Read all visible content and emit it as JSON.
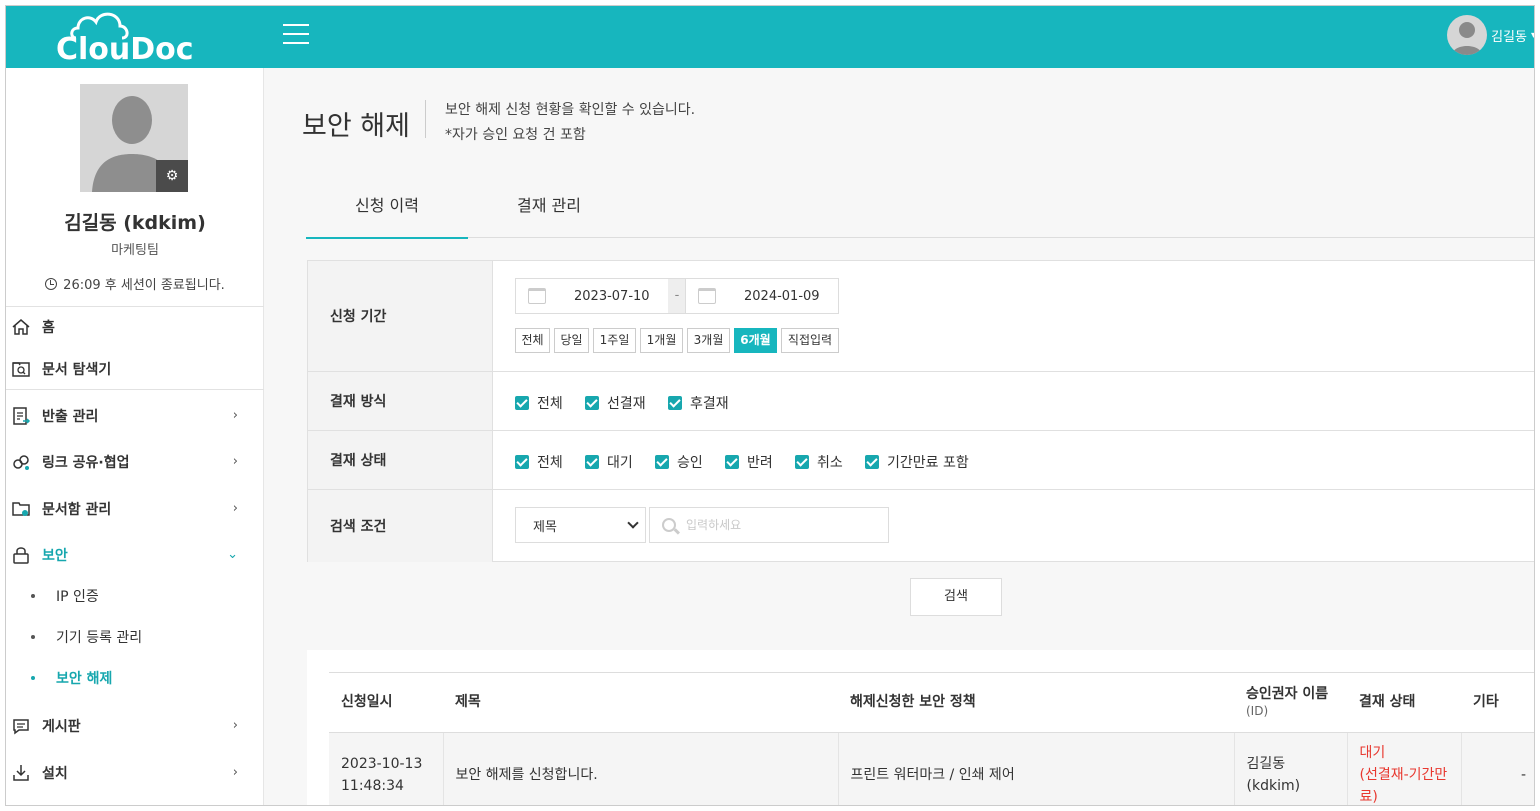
{
  "header": {
    "logo_text": "ClouDoc",
    "user_name": "김길동"
  },
  "sidebar": {
    "profile_name": "김길동 (kdkim)",
    "department": "마케팅팀",
    "session_text": "26:09 후 세션이 종료됩니다.",
    "items": [
      {
        "label": "홈",
        "icon": "home-icon"
      },
      {
        "label": "문서 탐색기",
        "icon": "folder-search-icon"
      },
      {
        "label": "반출 관리",
        "icon": "export-doc-icon"
      },
      {
        "label": "링크 공유·협업",
        "icon": "link-share-icon"
      },
      {
        "label": "문서함 관리",
        "icon": "folder-settings-icon"
      },
      {
        "label": "보안",
        "icon": "lock-icon"
      },
      {
        "label": "게시판",
        "icon": "board-icon"
      },
      {
        "label": "설치",
        "icon": "download-icon"
      }
    ],
    "security_sub": [
      "IP 인증",
      "기기 등록 관리",
      "보안 해제"
    ]
  },
  "page": {
    "title": "보안 해제",
    "desc_line1": "보안 해제 신청 현황을 확인할 수 있습니다.",
    "desc_line2": "*자가 승인 요청 건 포함"
  },
  "tabs": [
    "신청 이력",
    "결재 관리"
  ],
  "filter": {
    "period_label": "신청 기간",
    "date_from": "2023-07-10",
    "date_sep": "-",
    "date_to": "2024-01-09",
    "ranges": [
      "전체",
      "당일",
      "1주일",
      "1개월",
      "3개월",
      "6개월",
      "직접입력"
    ],
    "active_range": "6개월",
    "method_label": "결재 방식",
    "methods": [
      "전체",
      "선결재",
      "후결재"
    ],
    "status_label": "결재 상태",
    "statuses": [
      "전체",
      "대기",
      "승인",
      "반려",
      "취소",
      "기간만료 포함"
    ],
    "search_label": "검색 조건",
    "search_select": "제목",
    "search_placeholder": "입력하세요",
    "search_button": "검색"
  },
  "table": {
    "headers": {
      "date": "신청일시",
      "title": "제목",
      "policy": "해제신청한 보안 정책",
      "approver": "승인권자 이름",
      "approver_sub": "(ID)",
      "status": "결재 상태",
      "etc": "기타"
    },
    "rows": [
      {
        "date_line1": "2023-10-13",
        "date_line2": "11:48:34",
        "title": "보안 해제를 신청합니다.",
        "policy": "프린트 워터마크 / 인쇄 제어",
        "approver_line1": "김길동",
        "approver_line2": "(kdkim)",
        "status_line1": "대기",
        "status_line2": "(선결재-기간만",
        "status_line3": "료)",
        "etc": "-"
      }
    ]
  },
  "colors": {
    "brand": "#17b6be",
    "accent_text": "#17a7ae",
    "status_pending": "#e8382f"
  }
}
